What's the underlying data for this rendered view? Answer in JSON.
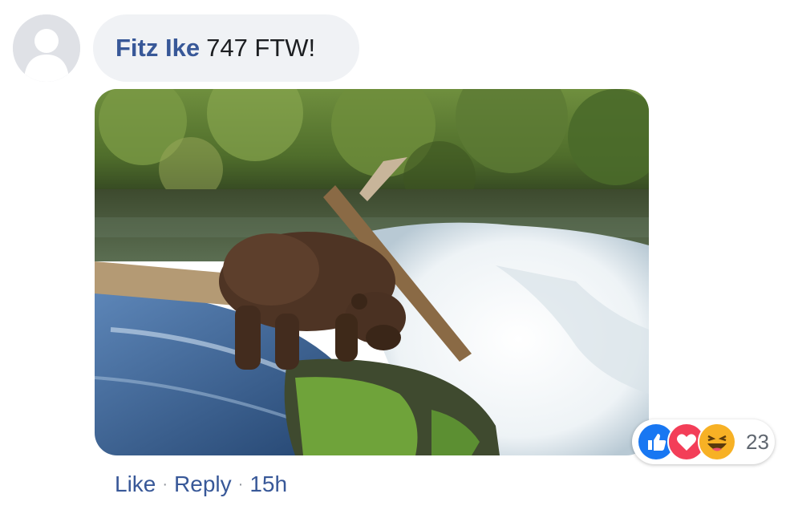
{
  "comment": {
    "author": "Fitz Ike",
    "text": "747 FTW!",
    "photo_alt": "bear standing on rock at waterfall"
  },
  "reactions": {
    "icons": [
      "like-icon",
      "love-icon",
      "haha-icon"
    ],
    "count": "23",
    "colors": {
      "like": "#1877f2",
      "love": "#f33e58",
      "haha": "#f7b125"
    }
  },
  "actions": {
    "like_label": "Like",
    "separator": "·",
    "reply_label": "Reply",
    "timestamp": "15h"
  },
  "colors": {
    "link": "#385898",
    "bubble": "#f0f2f5",
    "text": "#1c1e21"
  }
}
